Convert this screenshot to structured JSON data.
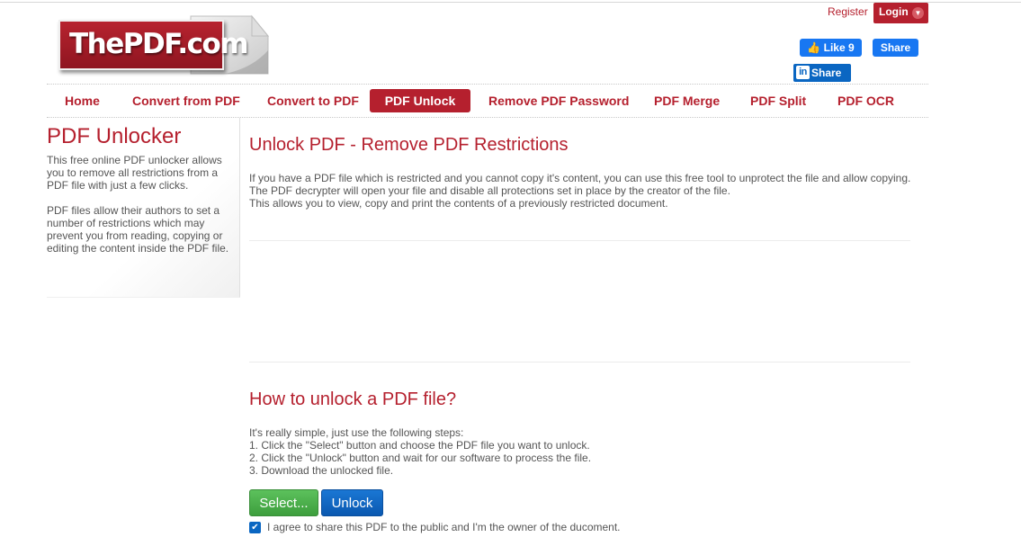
{
  "logo": {
    "text": "ThePDF.com"
  },
  "account": {
    "register": "Register",
    "login": "Login"
  },
  "social": {
    "fb_like": "Like 9",
    "fb_share": "Share",
    "li_share": "Share"
  },
  "nav": [
    {
      "label": "Home"
    },
    {
      "label": "Convert from PDF"
    },
    {
      "label": "Convert to PDF"
    },
    {
      "label": "PDF Unlock",
      "active": true
    },
    {
      "label": "Remove PDF Password"
    },
    {
      "label": "PDF Merge"
    },
    {
      "label": "PDF Split"
    },
    {
      "label": "PDF OCR"
    }
  ],
  "sidebar": {
    "title": "PDF Unlocker",
    "paragraphs": [
      [
        "This free online PDF unlocker allows",
        "you to remove all restrictions from a",
        "PDF file with just a few clicks."
      ],
      [
        "PDF files allow their authors to set a",
        "number of restrictions which may",
        "prevent you from reading, copying or",
        "editing the content inside the PDF file."
      ]
    ]
  },
  "main": {
    "title": "Unlock PDF - Remove PDF Restrictions",
    "intro": [
      "If you have a PDF file which is restricted and you cannot copy it's content, you can use this free tool to unprotect the file and allow copying.",
      "The PDF decrypter will open your file and disable all protections set in place by the creator of the file.",
      "This allows you to view, copy and print the contents of a previously restricted document."
    ],
    "how_title": "How to unlock a PDF file?",
    "steps": [
      "It's really simple, just use the following steps:",
      "1. Click the \"Select\" button and choose the PDF file you want to unlock.",
      "2. Click the \"Unlock\" button and wait for our software to process the file.",
      "3. Download the unlocked file."
    ],
    "select_button": "Select...",
    "unlock_button": "Unlock",
    "agree_text": "I agree to share this PDF to the public and I'm the owner of the ducoment.",
    "agree_checked": true
  },
  "colors": {
    "brand_red": "#b5202e",
    "facebook_blue": "#1877f2",
    "linkedin_blue": "#0a66c2",
    "select_green": "#4cb34c",
    "unlock_blue": "#0a62c2"
  }
}
